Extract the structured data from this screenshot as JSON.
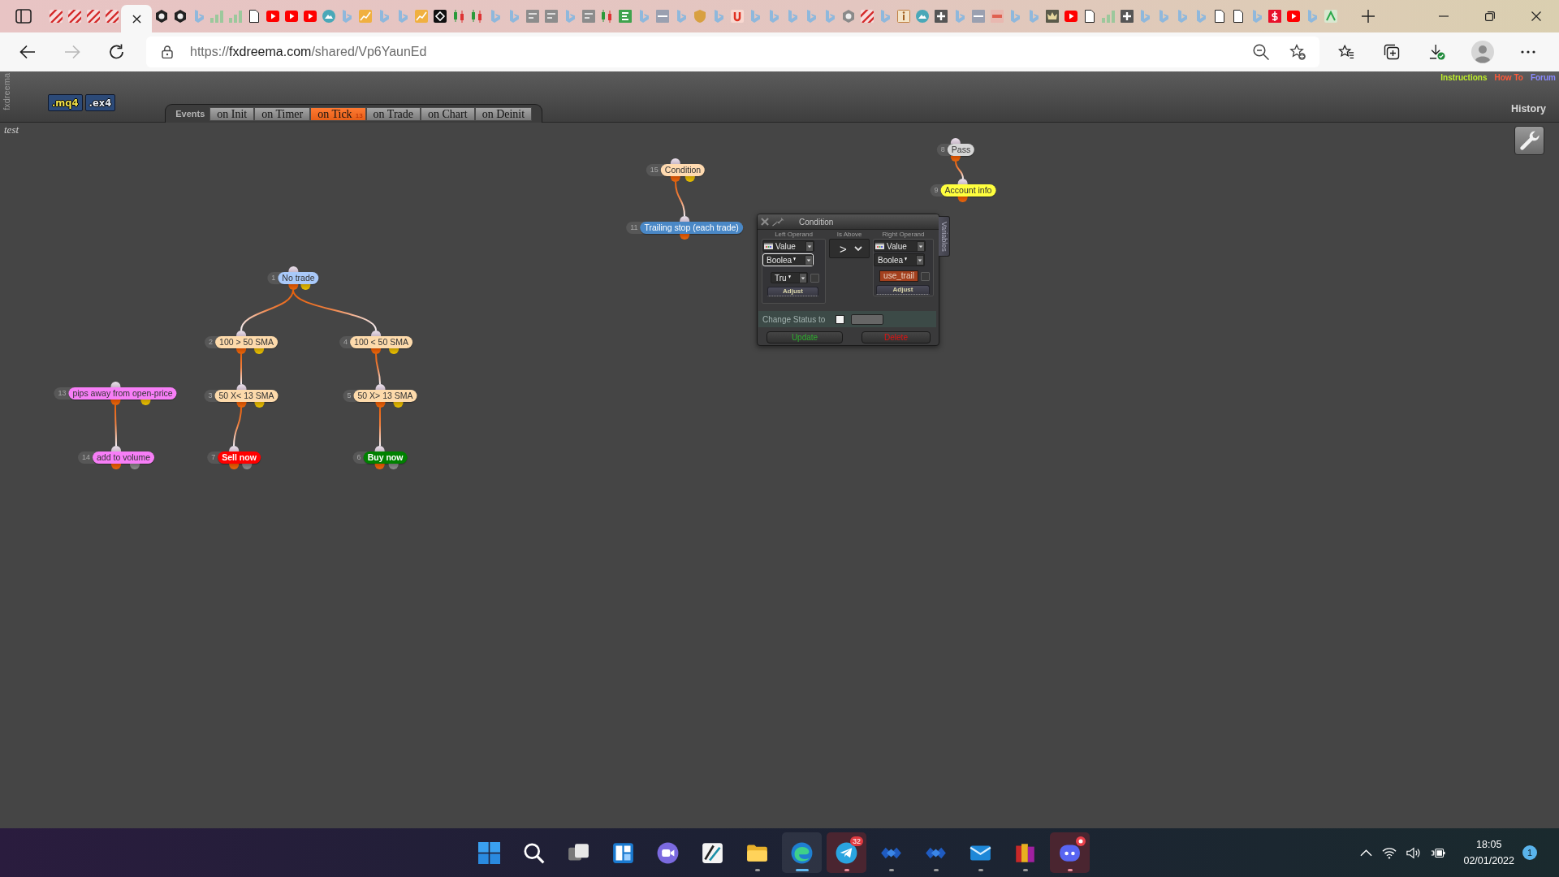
{
  "browser": {
    "tabs": [
      {
        "selected": false
      },
      {
        "selected": false
      },
      {
        "selected": false
      },
      {
        "selected": false
      },
      {
        "selected": true
      },
      {
        "selected": false
      },
      {
        "selected": false
      },
      {
        "selected": false
      },
      {
        "selected": false
      },
      {
        "selected": false
      },
      {
        "selected": false
      },
      {
        "selected": false
      },
      {
        "selected": false
      },
      {
        "selected": false
      },
      {
        "selected": false
      },
      {
        "selected": false
      },
      {
        "selected": false
      },
      {
        "selected": false
      },
      {
        "selected": false
      },
      {
        "selected": false
      },
      {
        "selected": false
      },
      {
        "selected": false
      },
      {
        "selected": false
      },
      {
        "selected": false
      },
      {
        "selected": false
      },
      {
        "selected": false
      },
      {
        "selected": false
      },
      {
        "selected": false
      },
      {
        "selected": false
      },
      {
        "selected": false
      },
      {
        "selected": false
      },
      {
        "selected": false
      },
      {
        "selected": false
      },
      {
        "selected": false
      },
      {
        "selected": false
      },
      {
        "selected": false
      },
      {
        "selected": false
      },
      {
        "selected": false
      },
      {
        "selected": false
      },
      {
        "selected": false
      },
      {
        "selected": false
      },
      {
        "selected": false
      },
      {
        "selected": false
      },
      {
        "selected": false
      },
      {
        "selected": false
      },
      {
        "selected": false
      },
      {
        "selected": false
      },
      {
        "selected": false
      },
      {
        "selected": false
      },
      {
        "selected": false
      },
      {
        "selected": false
      },
      {
        "selected": false
      },
      {
        "selected": false
      },
      {
        "selected": false
      },
      {
        "selected": false
      },
      {
        "selected": false
      },
      {
        "selected": false
      },
      {
        "selected": false
      },
      {
        "selected": false
      },
      {
        "selected": false
      },
      {
        "selected": false
      },
      {
        "selected": false
      },
      {
        "selected": false
      },
      {
        "selected": false
      },
      {
        "selected": false
      },
      {
        "selected": false
      },
      {
        "selected": false
      },
      {
        "selected": false
      },
      {
        "selected": false
      }
    ],
    "can_go_back": true,
    "can_go_forward": false,
    "url": {
      "scheme": "https://",
      "host": "fxdreema.com",
      "path": "/shared/Vp6YaunEd"
    }
  },
  "app": {
    "brand": "fxdreema",
    "exports": [
      {
        "label": ".mq4",
        "color": "#f2e24a"
      },
      {
        "label": ".ex4",
        "color": "#e6ecf5"
      }
    ],
    "events_label": "Events",
    "event_tabs": [
      {
        "label": "on Init",
        "selected": false
      },
      {
        "label": "on Timer",
        "selected": false
      },
      {
        "label": "on Tick",
        "selected": true,
        "badge": "13"
      },
      {
        "label": "on Trade",
        "selected": false
      },
      {
        "label": "on Chart",
        "selected": false
      },
      {
        "label": "on Deinit",
        "selected": false
      }
    ],
    "links": [
      {
        "label": "Instructions",
        "color": "#bff02a"
      },
      {
        "label": "How To",
        "color": "#ff5a3a"
      },
      {
        "label": "Forum",
        "color": "#8a8aff"
      }
    ],
    "history": "History",
    "project": "test"
  },
  "canvas": {
    "blocks": [
      {
        "number": "15",
        "label": "Condition",
        "color": "#ffdab0",
        "kind": "condition",
        "children": [
          {
            "number": "11",
            "label": "Trailing stop (each trade)",
            "color": "#4a88c6",
            "kind": "single"
          }
        ]
      },
      {
        "number": "8",
        "label": "Pass",
        "color": "#d6d6d6",
        "kind": "single",
        "children": [
          {
            "number": "9",
            "label": "Account info",
            "color": "#ffff3e",
            "kind": "single"
          }
        ]
      },
      {
        "number": "13",
        "label": "pips away from open-price",
        "color": "#f77ef7",
        "kind": "condition",
        "children": [
          {
            "number": "14",
            "label": "add to volume",
            "color": "#f77ef7",
            "kind": "action"
          }
        ]
      },
      {
        "number": "1",
        "label": "No trade",
        "color": "#a9c9f9",
        "kind": "condition",
        "children": [
          {
            "number": "2",
            "label": "100 > 50 SMA",
            "color": "#fddaab",
            "kind": "condition",
            "children": [
              {
                "number": "3",
                "label": "50 X< 13 SMA",
                "color": "#fddaab",
                "kind": "condition",
                "children": [
                  {
                    "number": "7",
                    "label": "Sell now",
                    "color": "#ff0000",
                    "kind": "trade"
                  }
                ]
              }
            ]
          },
          {
            "number": "4",
            "label": "100 < 50 SMA",
            "color": "#fddaab",
            "kind": "condition",
            "children": [
              {
                "number": "5",
                "label": "50 X> 13 SMA",
                "color": "#fddaab",
                "kind": "condition",
                "children": [
                  {
                    "number": "6",
                    "label": "Buy now",
                    "color": "#008000",
                    "kind": "trade"
                  }
                ]
              }
            ]
          }
        ]
      }
    ]
  },
  "condition_dialog": {
    "title": "Condition",
    "side_tab": "Variables",
    "left": {
      "heading": "Left Operand",
      "source": "Value",
      "type": {
        "value": "Boolea",
        "focused": true
      },
      "input": {
        "kind": "select",
        "text": "Tru",
        "checked": false
      },
      "adjust": "Adjust"
    },
    "operator": {
      "heading": "Is Above",
      "symbol": ">"
    },
    "right": {
      "heading": "Right Operand",
      "source": "Value",
      "type": {
        "value": "Boolea",
        "focused": false
      },
      "input": {
        "kind": "variable",
        "text": "use_trail",
        "checked": false
      },
      "adjust": "Adjust"
    },
    "status": {
      "label": "Change Status to",
      "checked": false
    },
    "buttons": [
      {
        "label": "Update",
        "color": "#2fae2f"
      },
      {
        "label": "Delete",
        "color": "#e01212"
      }
    ]
  },
  "taskbar": {
    "apps": [
      {
        "running": false,
        "active": false,
        "flashing": false,
        "dot": false
      },
      {
        "running": false,
        "active": false,
        "flashing": false,
        "dot": false
      },
      {
        "running": false,
        "active": false,
        "flashing": false,
        "dot": false
      },
      {
        "running": false,
        "active": false,
        "flashing": false,
        "dot": false
      },
      {
        "running": false,
        "active": false,
        "flashing": false,
        "dot": false
      },
      {
        "running": false,
        "active": false,
        "flashing": false,
        "dot": false
      },
      {
        "running": true,
        "active": false,
        "flashing": false,
        "dot": false
      },
      {
        "running": true,
        "active": true,
        "flashing": false,
        "dot": false
      },
      {
        "running": true,
        "active": false,
        "flashing": true,
        "dot": false,
        "badge": "32"
      },
      {
        "running": true,
        "active": false,
        "flashing": false,
        "dot": false
      },
      {
        "running": true,
        "active": false,
        "flashing": false,
        "dot": false
      },
      {
        "running": true,
        "active": false,
        "flashing": false,
        "dot": false
      },
      {
        "running": true,
        "active": false,
        "flashing": false,
        "dot": false
      },
      {
        "running": true,
        "active": false,
        "flashing": true,
        "dot": true
      }
    ],
    "clock": {
      "time": "18:05",
      "date": "02/01/2022"
    },
    "notifications": "1"
  }
}
